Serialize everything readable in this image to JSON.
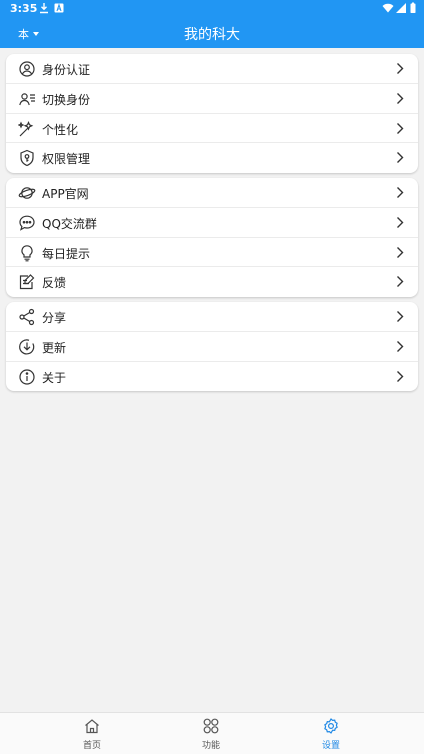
{
  "status_bar": {
    "time": "3:35"
  },
  "header": {
    "title": "我的科大",
    "switch_label": "本"
  },
  "groups": [
    {
      "items": [
        {
          "label": "身份认证",
          "icon": "user-circle-icon"
        },
        {
          "label": "切换身份",
          "icon": "user-switch-icon"
        },
        {
          "label": "个性化",
          "icon": "magic-wand-icon"
        },
        {
          "label": "权限管理",
          "icon": "shield-key-icon"
        }
      ]
    },
    {
      "items": [
        {
          "label": "APP官网",
          "icon": "planet-icon"
        },
        {
          "label": "QQ交流群",
          "icon": "chat-bubble-icon"
        },
        {
          "label": "每日提示",
          "icon": "lightbulb-icon"
        },
        {
          "label": "反馈",
          "icon": "edit-note-icon"
        }
      ]
    },
    {
      "items": [
        {
          "label": "分享",
          "icon": "share-icon"
        },
        {
          "label": "更新",
          "icon": "download-circle-icon"
        },
        {
          "label": "关于",
          "icon": "info-circle-icon"
        }
      ]
    }
  ],
  "bottom_nav": [
    {
      "label": "首页",
      "icon": "home-icon",
      "active": false
    },
    {
      "label": "功能",
      "icon": "grid-circles-icon",
      "active": false
    },
    {
      "label": "设置",
      "icon": "gear-icon",
      "active": true
    }
  ],
  "colors": {
    "primary": "#2196f3",
    "active_tab": "#1e88e5",
    "background": "#f2f2f2"
  }
}
